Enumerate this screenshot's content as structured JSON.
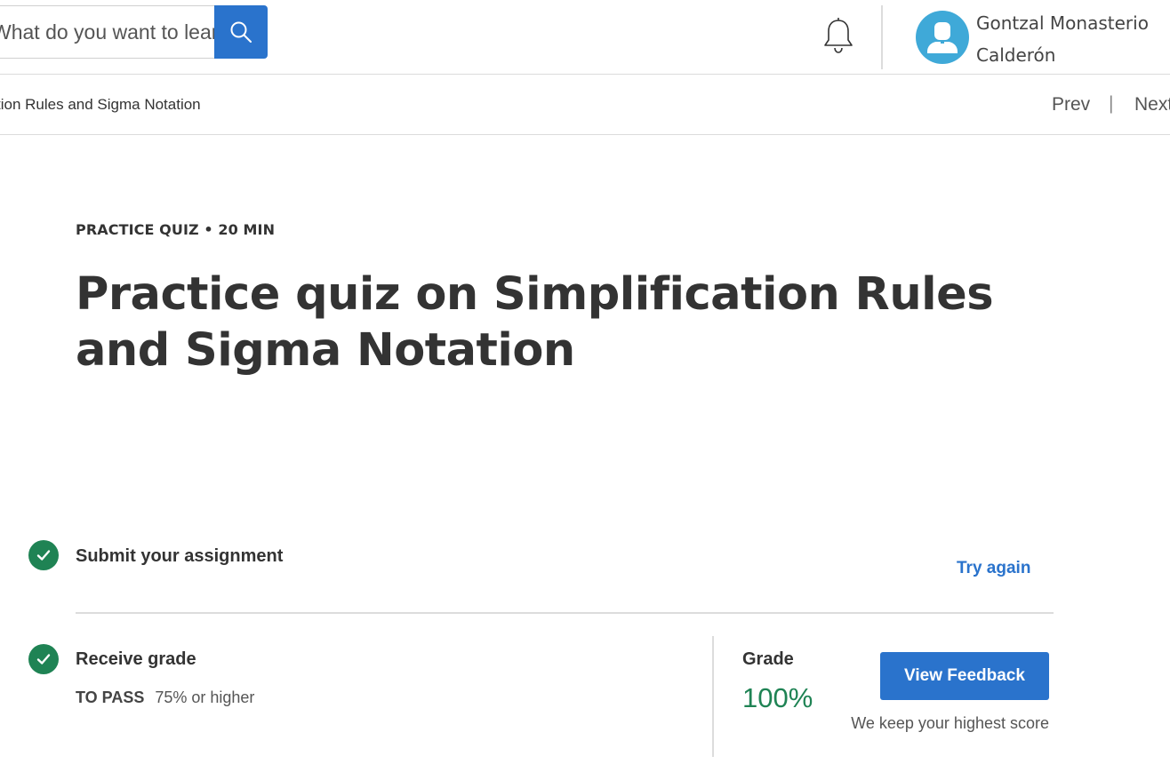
{
  "header": {
    "search_placeholder": "What do you want to learn?",
    "search_icon": "search-icon",
    "notification_icon": "bell-icon",
    "user": {
      "name_line1": "Gontzal Monasterio",
      "name_line2": "Calderón",
      "avatar_icon": "person-icon"
    }
  },
  "subnav": {
    "breadcrumb": "tion Rules and Sigma Notation",
    "prev": "Prev",
    "separator": "|",
    "next": "Next"
  },
  "quiz": {
    "kicker": "PRACTICE QUIZ • 20 MIN",
    "title": "Practice quiz on Simplification Rules and Sigma Notation"
  },
  "steps": {
    "submit": {
      "label": "Submit your assignment",
      "action": "Try again",
      "status_icon": "check-icon"
    },
    "receive": {
      "label": "Receive grade",
      "to_pass_label": "TO PASS",
      "to_pass_value": "75% or higher",
      "status_icon": "check-icon"
    }
  },
  "grade": {
    "label": "Grade",
    "value": "100%",
    "button": "View Feedback",
    "note": "We keep your highest score"
  },
  "colors": {
    "accent": "#2a73cc",
    "success": "#1f8354",
    "avatar_bg": "#3fa9d8"
  }
}
